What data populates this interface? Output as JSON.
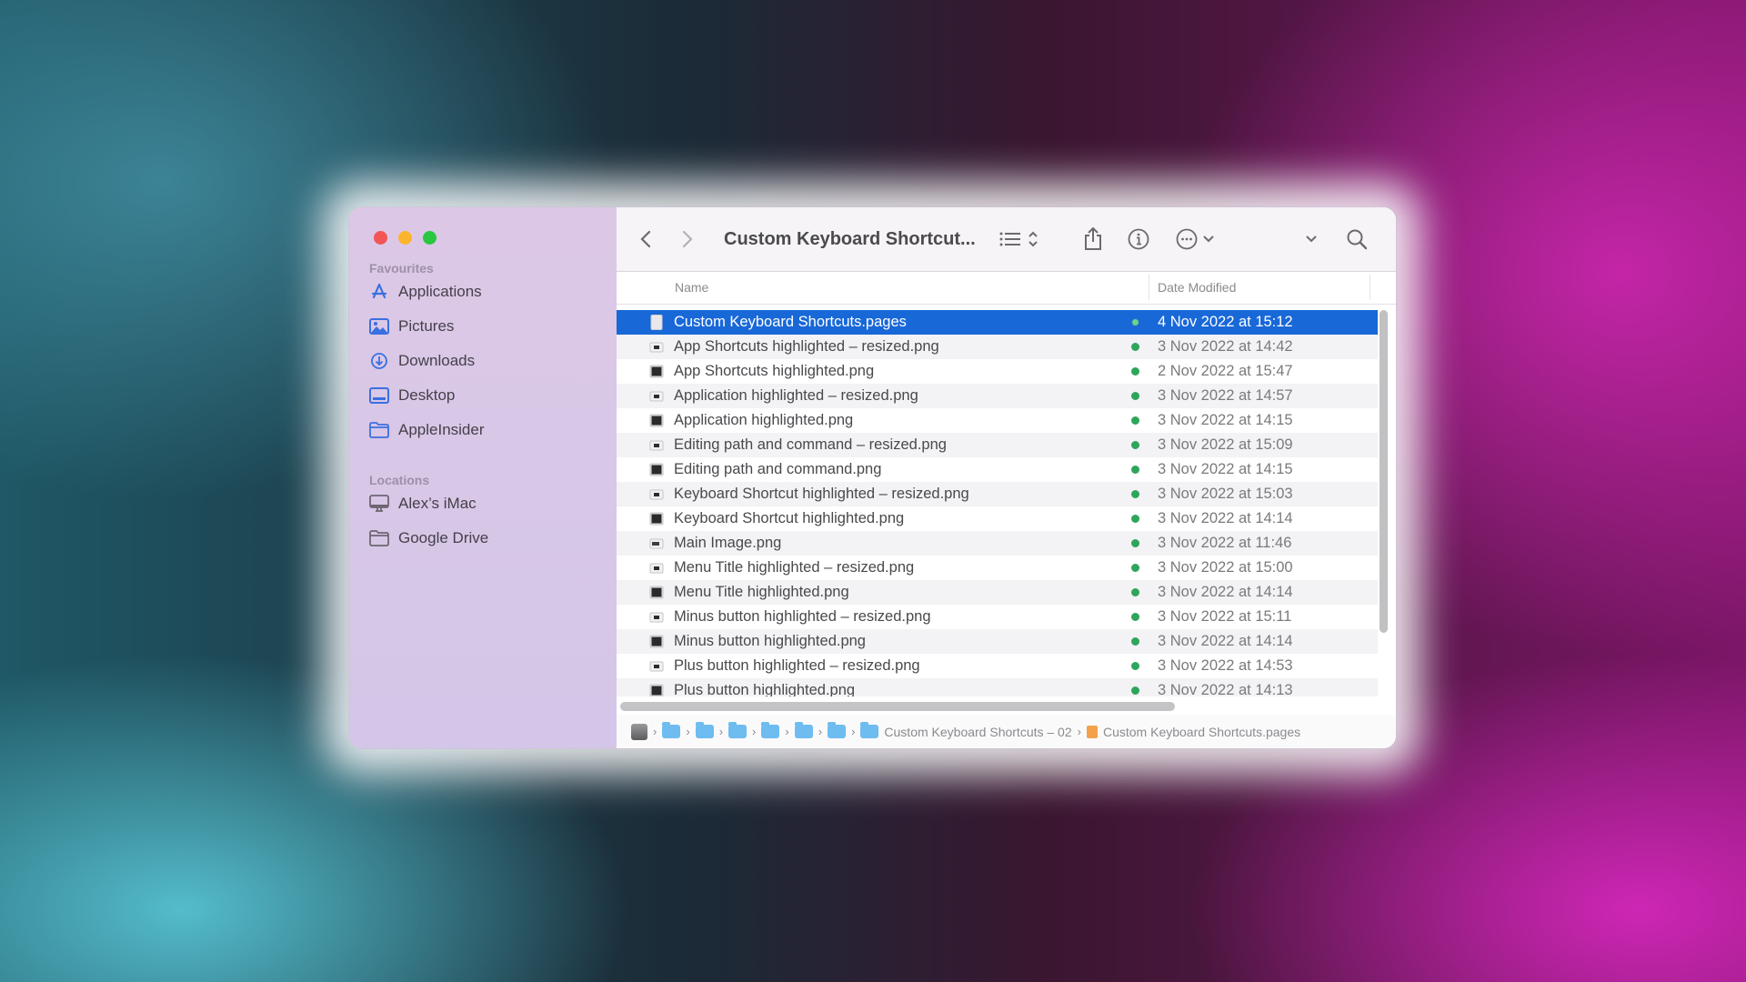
{
  "window": {
    "title": "Custom Keyboard Shortcut...",
    "traffic_lights": [
      "close",
      "minimize",
      "zoom"
    ]
  },
  "sidebar": {
    "sections": [
      {
        "label": "Favourites",
        "items": [
          {
            "label": "Applications",
            "icon": "applications-icon"
          },
          {
            "label": "Pictures",
            "icon": "pictures-icon"
          },
          {
            "label": "Downloads",
            "icon": "downloads-icon"
          },
          {
            "label": "Desktop",
            "icon": "desktop-icon"
          },
          {
            "label": "AppleInsider",
            "icon": "folder-icon"
          }
        ]
      },
      {
        "label": "Locations",
        "items": [
          {
            "label": "Alex’s iMac",
            "icon": "imac-icon"
          },
          {
            "label": "Google Drive",
            "icon": "folder-icon"
          }
        ]
      }
    ]
  },
  "toolbar": {
    "back": "back-icon",
    "forward": "forward-icon",
    "view_mode": "list-view-icon",
    "share": "share-icon",
    "info": "info-icon",
    "more": "more-actions-icon",
    "overflow": "chevron-down-icon",
    "search": "search-icon"
  },
  "columns": {
    "name": "Name",
    "date": "Date Modified"
  },
  "files": [
    {
      "name": "Custom Keyboard Shortcuts.pages",
      "date": "4 Nov 2022 at 15:12",
      "type": "pages",
      "selected": true
    },
    {
      "name": "App Shortcuts highlighted – resized.png",
      "date": "3 Nov 2022 at 14:42",
      "type": "png-small"
    },
    {
      "name": "App Shortcuts highlighted.png",
      "date": "2 Nov 2022 at 15:47",
      "type": "png"
    },
    {
      "name": "Application highlighted – resized.png",
      "date": "3 Nov 2022 at 14:57",
      "type": "png-small"
    },
    {
      "name": "Application highlighted.png",
      "date": "3 Nov 2022 at 14:15",
      "type": "png"
    },
    {
      "name": "Editing path and command – resized.png",
      "date": "3 Nov 2022 at 15:09",
      "type": "png-small"
    },
    {
      "name": "Editing path and command.png",
      "date": "3 Nov 2022 at 14:15",
      "type": "png"
    },
    {
      "name": "Keyboard Shortcut highlighted – resized.png",
      "date": "3 Nov 2022 at 15:03",
      "type": "png-small"
    },
    {
      "name": "Keyboard Shortcut highlighted.png",
      "date": "3 Nov 2022 at 14:14",
      "type": "png"
    },
    {
      "name": "Main Image.png",
      "date": "3 Nov 2022 at 11:46",
      "type": "png-wide"
    },
    {
      "name": "Menu Title highlighted – resized.png",
      "date": "3 Nov 2022 at 15:00",
      "type": "png-small"
    },
    {
      "name": "Menu Title highlighted.png",
      "date": "3 Nov 2022 at 14:14",
      "type": "png"
    },
    {
      "name": "Minus button highlighted – resized.png",
      "date": "3 Nov 2022 at 15:11",
      "type": "png-small"
    },
    {
      "name": "Minus button highlighted.png",
      "date": "3 Nov 2022 at 14:14",
      "type": "png"
    },
    {
      "name": "Plus button highlighted – resized.png",
      "date": "3 Nov 2022 at 14:53",
      "type": "png-small"
    },
    {
      "name": "Plus button highlighted.png",
      "date": "3 Nov 2022 at 14:13",
      "type": "png"
    }
  ],
  "sync_status": "synced",
  "colors": {
    "selection": "#1868d8",
    "sync_dot": "#2ea55c",
    "sidebar_icon": "#3a6fe0"
  },
  "pathbar": {
    "crumbs": [
      {
        "type": "disk",
        "label": ""
      },
      {
        "type": "folder",
        "label": ""
      },
      {
        "type": "folder",
        "label": ""
      },
      {
        "type": "folder",
        "label": ""
      },
      {
        "type": "folder",
        "label": ""
      },
      {
        "type": "folder",
        "label": ""
      },
      {
        "type": "folder",
        "label": ""
      },
      {
        "type": "folder",
        "label": "Custom Keyboard Shortcuts – 02"
      },
      {
        "type": "pages",
        "label": "Custom Keyboard Shortcuts.pages"
      }
    ]
  }
}
